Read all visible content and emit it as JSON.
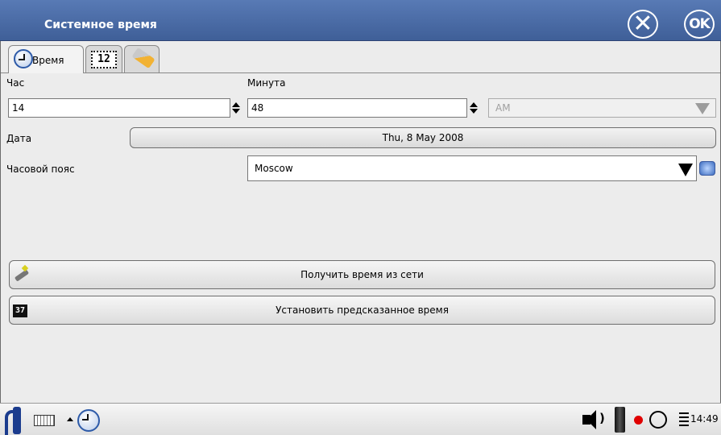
{
  "window": {
    "title": "Системное время",
    "close_icon": "close-circle-icon",
    "ok_label": "OK"
  },
  "tabs": [
    {
      "label": "Время",
      "icon": "clock-icon",
      "active": true
    },
    {
      "label": "",
      "icon": "calendar-icon",
      "calendar_text": "12",
      "active": false
    },
    {
      "label": "",
      "icon": "wrench-icon",
      "active": false
    }
  ],
  "form": {
    "hour_label": "Час",
    "minute_label": "Минута",
    "hour_value": "14",
    "minute_value": "48",
    "ampm_value": "AM",
    "date_label": "Дата",
    "date_value": "Thu, 8 May 2008",
    "timezone_label": "Часовой пояс",
    "timezone_value": "Moscow"
  },
  "buttons": {
    "net_time": "Получить время из сети",
    "predicted_time": "Установить предсказанное время",
    "predicted_icon_text": "37"
  },
  "taskbar": {
    "items": [
      "opie-menu-icon",
      "keyboard-icon",
      "up-arrow-icon",
      "clock-app-icon",
      "speaker-icon",
      "battery-icon",
      "record-icon",
      "circle-icon",
      "menu-lines-icon"
    ],
    "speaker_waves": ")",
    "time": "14:49"
  }
}
